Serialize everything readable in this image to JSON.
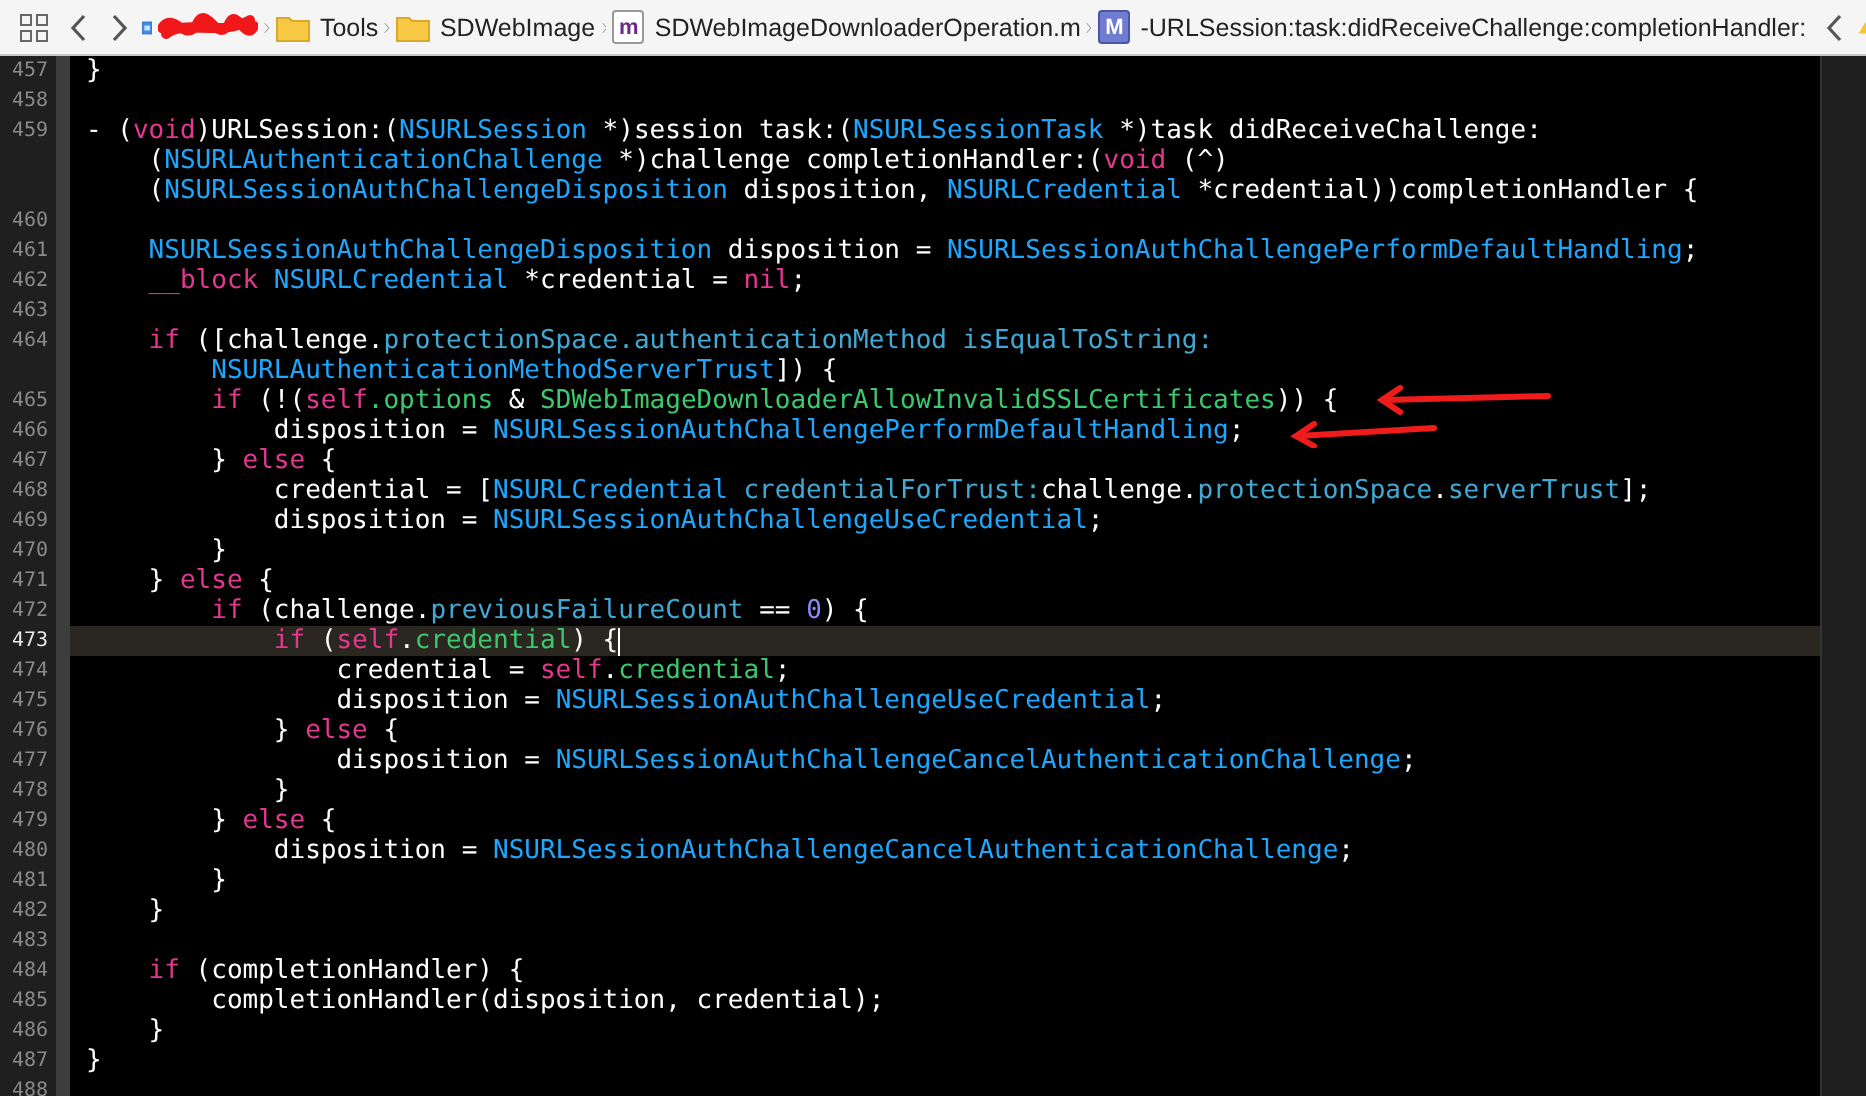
{
  "toolbar": {
    "breadcrumbs": [
      {
        "kind": "redacted"
      },
      {
        "kind": "folder",
        "label": "Tools"
      },
      {
        "kind": "folder",
        "label": "SDWebImage"
      },
      {
        "kind": "file",
        "icon_letter": "m",
        "label": "SDWebImageDownloaderOperation.m"
      },
      {
        "kind": "method",
        "icon_letter": "M",
        "label": "-URLSession:task:didReceiveChallenge:completionHandler:"
      }
    ]
  },
  "editor": {
    "lines": [
      {
        "number": "457",
        "current": false,
        "rows": [
          {
            "segments": [
              {
                "kind": "plain",
                "text": "}"
              }
            ]
          }
        ]
      },
      {
        "number": "458",
        "current": false,
        "rows": [
          {}
        ]
      },
      {
        "number": "459",
        "current": false,
        "rows": [
          {
            "segments": [
              {
                "kind": "plain",
                "text": "- ("
              },
              {
                "kind": "keyword",
                "text": "void"
              },
              {
                "kind": "plain",
                "text": ")URLSession:("
              },
              {
                "kind": "type",
                "text": "NSURLSession"
              },
              {
                "kind": "plain",
                "text": " *)session task:("
              },
              {
                "kind": "type",
                "text": "NSURLSessionTask"
              },
              {
                "kind": "plain",
                "text": " *)task didReceiveChallenge:"
              }
            ]
          },
          {
            "segments": [
              {
                "kind": "plain",
                "text": "    ("
              },
              {
                "kind": "type",
                "text": "NSURLAuthenticationChallenge"
              },
              {
                "kind": "plain",
                "text": " *)challenge completionHandler:("
              },
              {
                "kind": "keyword",
                "text": "void"
              },
              {
                "kind": "plain",
                "text": " (^)"
              }
            ]
          },
          {
            "segments": [
              {
                "kind": "plain",
                "text": "    ("
              },
              {
                "kind": "type",
                "text": "NSURLSessionAuthChallengeDisposition"
              },
              {
                "kind": "plain",
                "text": " disposition, "
              },
              {
                "kind": "type",
                "text": "NSURLCredential"
              },
              {
                "kind": "plain",
                "text": " *credential))completionHandler {"
              }
            ]
          }
        ]
      },
      {
        "number": "460",
        "current": false,
        "rows": [
          {}
        ]
      },
      {
        "number": "461",
        "current": false,
        "rows": [
          {
            "segments": [
              {
                "kind": "type",
                "text": "    NSURLSessionAuthChallengeDisposition"
              },
              {
                "kind": "plain",
                "text": " disposition = "
              },
              {
                "kind": "type",
                "text": "NSURLSessionAuthChallengePerformDefaultHandling"
              },
              {
                "kind": "plain",
                "text": ";"
              }
            ]
          }
        ]
      },
      {
        "number": "462",
        "current": false,
        "rows": [
          {
            "segments": [
              {
                "kind": "keyword",
                "text": "    __block"
              },
              {
                "kind": "type",
                "text": " NSURLCredential"
              },
              {
                "kind": "plain",
                "text": " *credential = "
              },
              {
                "kind": "keyword",
                "text": "nil"
              },
              {
                "kind": "plain",
                "text": ";"
              }
            ]
          }
        ]
      },
      {
        "number": "463",
        "current": false,
        "rows": [
          {}
        ]
      },
      {
        "number": "464",
        "current": false,
        "rows": [
          {
            "segments": [
              {
                "kind": "keyword",
                "text": "    if"
              },
              {
                "kind": "plain",
                "text": " ([challenge."
              },
              {
                "kind": "member",
                "text": "protectionSpace.authenticationMethod isEqualToString:"
              }
            ]
          },
          {
            "segments": [
              {
                "kind": "type",
                "text": "        NSURLAuthenticationMethodServerTrust"
              },
              {
                "kind": "plain",
                "text": "]) {"
              }
            ]
          }
        ]
      },
      {
        "number": "465",
        "current": false,
        "rows": [
          {
            "segments": [
              {
                "kind": "keyword",
                "text": "        if"
              },
              {
                "kind": "plain",
                "text": " (!("
              },
              {
                "kind": "keyword",
                "text": "self"
              },
              {
                "kind": "project",
                "text": ".options"
              },
              {
                "kind": "plain",
                "text": " & "
              },
              {
                "kind": "project",
                "text": "SDWebImageDownloaderAllowInvalidSSLCertificates"
              },
              {
                "kind": "plain",
                "text": ")) {"
              }
            ]
          }
        ]
      },
      {
        "number": "466",
        "current": false,
        "rows": [
          {
            "segments": [
              {
                "kind": "plain",
                "text": "            disposition = "
              },
              {
                "kind": "type",
                "text": "NSURLSessionAuthChallengePerformDefaultHandling"
              },
              {
                "kind": "plain",
                "text": ";"
              }
            ]
          }
        ]
      },
      {
        "number": "467",
        "current": false,
        "rows": [
          {
            "segments": [
              {
                "kind": "plain",
                "text": "        } "
              },
              {
                "kind": "keyword",
                "text": "else"
              },
              {
                "kind": "plain",
                "text": " {"
              }
            ]
          }
        ]
      },
      {
        "number": "468",
        "current": false,
        "rows": [
          {
            "segments": [
              {
                "kind": "plain",
                "text": "            credential = ["
              },
              {
                "kind": "type",
                "text": "NSURLCredential"
              },
              {
                "kind": "member",
                "text": " credentialForTrust:"
              },
              {
                "kind": "plain",
                "text": "challenge."
              },
              {
                "kind": "member",
                "text": "protectionSpace"
              },
              {
                "kind": "plain",
                "text": "."
              },
              {
                "kind": "member",
                "text": "serverTrust"
              },
              {
                "kind": "plain",
                "text": "];"
              }
            ]
          }
        ]
      },
      {
        "number": "469",
        "current": false,
        "rows": [
          {
            "segments": [
              {
                "kind": "plain",
                "text": "            disposition = "
              },
              {
                "kind": "type",
                "text": "NSURLSessionAuthChallengeUseCredential"
              },
              {
                "kind": "plain",
                "text": ";"
              }
            ]
          }
        ]
      },
      {
        "number": "470",
        "current": false,
        "rows": [
          {
            "segments": [
              {
                "kind": "plain",
                "text": "        }"
              }
            ]
          }
        ]
      },
      {
        "number": "471",
        "current": false,
        "rows": [
          {
            "segments": [
              {
                "kind": "plain",
                "text": "    } "
              },
              {
                "kind": "keyword",
                "text": "else"
              },
              {
                "kind": "plain",
                "text": " {"
              }
            ]
          }
        ]
      },
      {
        "number": "472",
        "current": false,
        "rows": [
          {
            "segments": [
              {
                "kind": "keyword",
                "text": "        if"
              },
              {
                "kind": "plain",
                "text": " (challenge."
              },
              {
                "kind": "member",
                "text": "previousFailureCount"
              },
              {
                "kind": "plain",
                "text": " == "
              },
              {
                "kind": "number",
                "text": "0"
              },
              {
                "kind": "plain",
                "text": ") {"
              }
            ]
          }
        ]
      },
      {
        "number": "473",
        "current": true,
        "rows": [
          {
            "segments": [
              {
                "kind": "keyword",
                "text": "            if"
              },
              {
                "kind": "plain",
                "text": " ("
              },
              {
                "kind": "keyword",
                "text": "self"
              },
              {
                "kind": "plain",
                "text": "."
              },
              {
                "kind": "project",
                "text": "credential"
              },
              {
                "kind": "plain",
                "text": ") {"
              }
            ]
          }
        ]
      },
      {
        "number": "474",
        "current": false,
        "rows": [
          {
            "segments": [
              {
                "kind": "plain",
                "text": "                credential = "
              },
              {
                "kind": "keyword",
                "text": "self"
              },
              {
                "kind": "plain",
                "text": "."
              },
              {
                "kind": "project",
                "text": "credential"
              },
              {
                "kind": "plain",
                "text": ";"
              }
            ]
          }
        ]
      },
      {
        "number": "475",
        "current": false,
        "rows": [
          {
            "segments": [
              {
                "kind": "plain",
                "text": "                disposition = "
              },
              {
                "kind": "type",
                "text": "NSURLSessionAuthChallengeUseCredential"
              },
              {
                "kind": "plain",
                "text": ";"
              }
            ]
          }
        ]
      },
      {
        "number": "476",
        "current": false,
        "rows": [
          {
            "segments": [
              {
                "kind": "plain",
                "text": "            } "
              },
              {
                "kind": "keyword",
                "text": "else"
              },
              {
                "kind": "plain",
                "text": " {"
              }
            ]
          }
        ]
      },
      {
        "number": "477",
        "current": false,
        "rows": [
          {
            "segments": [
              {
                "kind": "plain",
                "text": "                disposition = "
              },
              {
                "kind": "type",
                "text": "NSURLSessionAuthChallengeCancelAuthenticationChallenge"
              },
              {
                "kind": "plain",
                "text": ";"
              }
            ]
          }
        ]
      },
      {
        "number": "478",
        "current": false,
        "rows": [
          {
            "segments": [
              {
                "kind": "plain",
                "text": "            }"
              }
            ]
          }
        ]
      },
      {
        "number": "479",
        "current": false,
        "rows": [
          {
            "segments": [
              {
                "kind": "plain",
                "text": "        } "
              },
              {
                "kind": "keyword",
                "text": "else"
              },
              {
                "kind": "plain",
                "text": " {"
              }
            ]
          }
        ]
      },
      {
        "number": "480",
        "current": false,
        "rows": [
          {
            "segments": [
              {
                "kind": "plain",
                "text": "            disposition = "
              },
              {
                "kind": "type",
                "text": "NSURLSessionAuthChallengeCancelAuthenticationChallenge"
              },
              {
                "kind": "plain",
                "text": ";"
              }
            ]
          }
        ]
      },
      {
        "number": "481",
        "current": false,
        "rows": [
          {
            "segments": [
              {
                "kind": "plain",
                "text": "        }"
              }
            ]
          }
        ]
      },
      {
        "number": "482",
        "current": false,
        "rows": [
          {
            "segments": [
              {
                "kind": "plain",
                "text": "    }"
              }
            ]
          }
        ]
      },
      {
        "number": "483",
        "current": false,
        "rows": [
          {}
        ]
      },
      {
        "number": "484",
        "current": false,
        "rows": [
          {
            "segments": [
              {
                "kind": "keyword",
                "text": "    if"
              },
              {
                "kind": "plain",
                "text": " (completionHandler) {"
              }
            ]
          }
        ]
      },
      {
        "number": "485",
        "current": false,
        "rows": [
          {
            "segments": [
              {
                "kind": "plain",
                "text": "        completionHandler(disposition, credential);"
              }
            ]
          }
        ]
      },
      {
        "number": "486",
        "current": false,
        "rows": [
          {
            "segments": [
              {
                "kind": "plain",
                "text": "    }"
              }
            ]
          }
        ]
      },
      {
        "number": "487",
        "current": false,
        "rows": [
          {
            "segments": [
              {
                "kind": "plain",
                "text": "}"
              }
            ]
          }
        ]
      },
      {
        "number": "488",
        "current": false,
        "rows": [
          {}
        ]
      }
    ]
  }
}
